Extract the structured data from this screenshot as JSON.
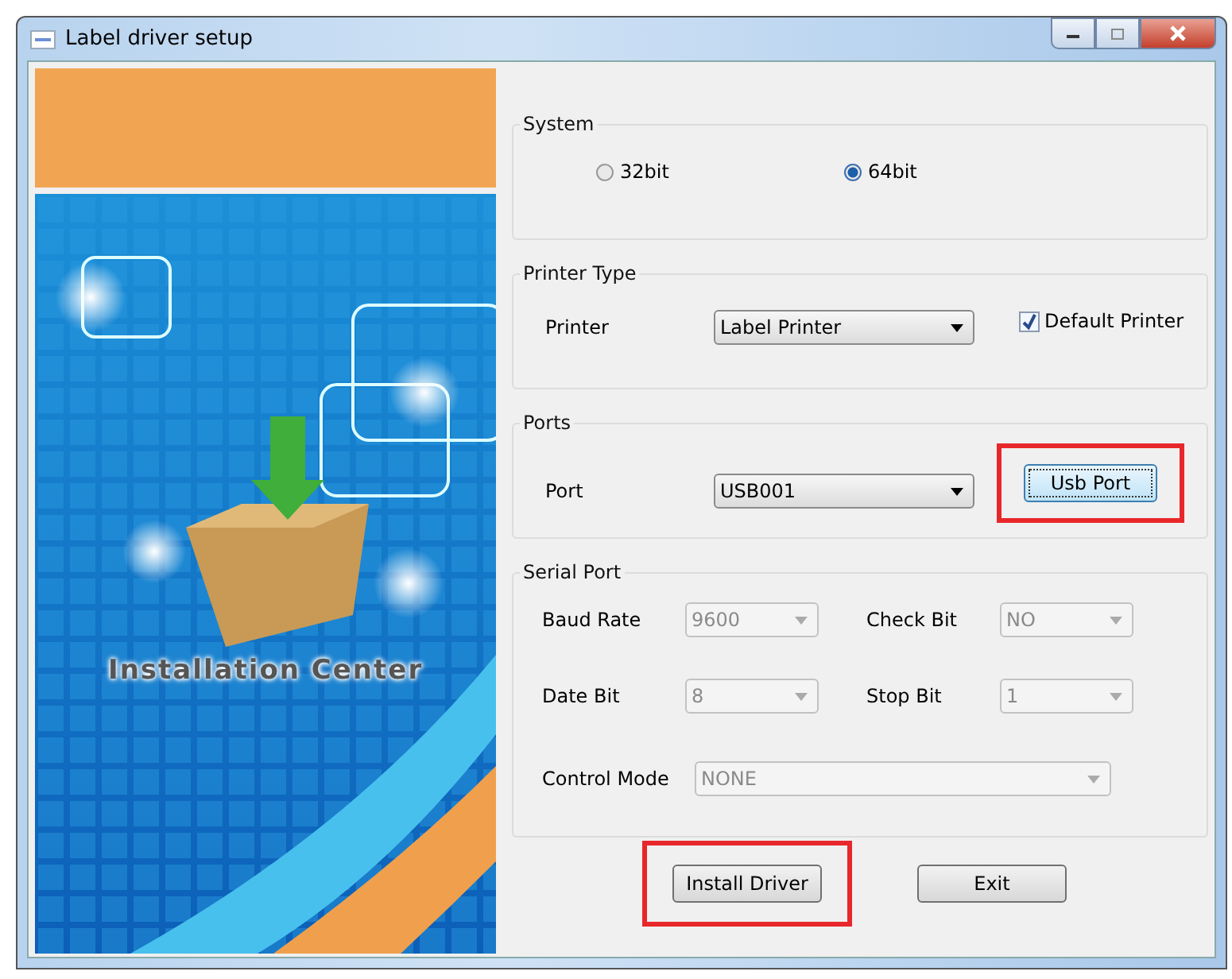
{
  "window": {
    "title": "Label driver setup"
  },
  "banner": {
    "caption": "Installation Center"
  },
  "system": {
    "title": "System",
    "options": [
      {
        "label": "32bit",
        "selected": false
      },
      {
        "label": "64bit",
        "selected": true
      }
    ]
  },
  "printer_type": {
    "title": "Printer Type",
    "label": "Printer",
    "value": "Label Printer",
    "default_printer": {
      "label": "Default Printer",
      "checked": true
    }
  },
  "ports": {
    "title": "Ports",
    "label": "Port",
    "value": "USB001",
    "button": {
      "label": "Usb Port",
      "highlighted": true,
      "focused": true
    }
  },
  "serial_port": {
    "title": "Serial Port",
    "fields": [
      {
        "label": "Baud Rate",
        "value": "9600",
        "disabled": true
      },
      {
        "label": "Check Bit",
        "value": "NO",
        "disabled": true
      },
      {
        "label": "Date Bit",
        "value": "8",
        "disabled": true
      },
      {
        "label": "Stop Bit",
        "value": "1",
        "disabled": true
      }
    ],
    "control_mode": {
      "label": "Control Mode",
      "value": "NONE",
      "disabled": true
    }
  },
  "buttons": [
    {
      "label": "Install Driver",
      "highlighted": true,
      "focused": false
    },
    {
      "label": "Exit",
      "highlighted": false,
      "focused": false
    }
  ]
}
